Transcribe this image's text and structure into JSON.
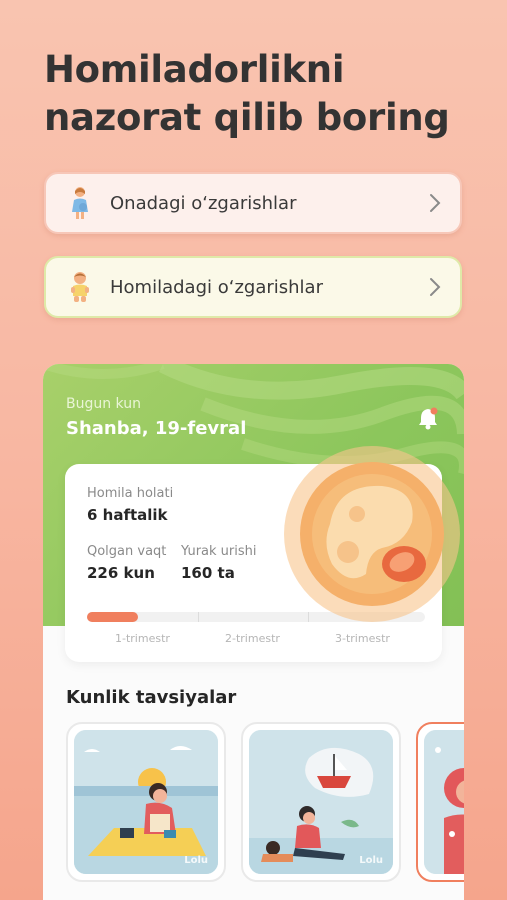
{
  "headline": "Homiladorlikni nazorat qilib boring",
  "nav": {
    "mother_changes": "Onadagi o‘zgarishlar",
    "fetus_changes": "Homiladagi o‘zgarishlar"
  },
  "today": {
    "label": "Bugun kun",
    "date": "Shanba, 19-fevral"
  },
  "status": {
    "fetus_label": "Homila holati",
    "fetus_value": "6 haftalik",
    "remaining_label": "Qolgan vaqt",
    "remaining_value": "226 kun",
    "heartbeat_label": "Yurak urishi",
    "heartbeat_value": "160 ta",
    "progress_fraction": 0.15,
    "trimesters": [
      "1-trimestr",
      "2-trimestr",
      "3-trimestr"
    ]
  },
  "daily": {
    "title": "Kunlik tavsiyalar",
    "cards": [
      {
        "brand": "Lolu",
        "icon": "woman-cooking-picnic-illustration"
      },
      {
        "brand": "Lolu",
        "icon": "woman-reading-child-illustration"
      },
      {
        "brand": "",
        "icon": "woman-partial-illustration"
      }
    ]
  },
  "colors": {
    "accent_orange": "#f07f5e",
    "green_header": "#8cc65c",
    "background": "#f8b7a2"
  }
}
